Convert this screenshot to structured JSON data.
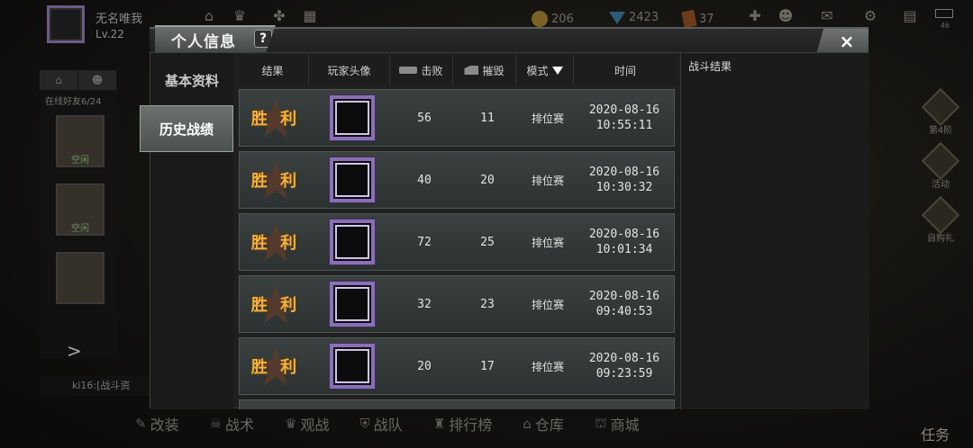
{
  "hud": {
    "player_name": "无名唯我",
    "player_level": "Lv.22",
    "coins": "206",
    "gems": "2423",
    "tickets": "37",
    "battery_label": "46"
  },
  "left_panel": {
    "online_text": "在线好友6/24",
    "friend_label": "空闲"
  },
  "chat_text": "ki16:[战斗资",
  "right_side": [
    "第4阶",
    "活动",
    "自购礼"
  ],
  "bottom_nav": [
    "改装",
    "战术",
    "观战",
    "战队",
    "排行榜",
    "仓库",
    "商城"
  ],
  "mission_label": "任务",
  "modal": {
    "title": "个人信息",
    "help": "?",
    "close": "×",
    "side_nav": [
      "基本资料",
      "历史战绩"
    ],
    "columns": {
      "result": "结果",
      "avatar": "玩家头像",
      "kills": "击败",
      "destroy": "摧毁",
      "mode": "模式",
      "time": "时间"
    },
    "rows": [
      {
        "result": "胜 利",
        "kills": "56",
        "destroy": "11",
        "mode": "排位赛",
        "date": "2020-08-16",
        "time": "10:55:11"
      },
      {
        "result": "胜 利",
        "kills": "40",
        "destroy": "20",
        "mode": "排位赛",
        "date": "2020-08-16",
        "time": "10:30:32"
      },
      {
        "result": "胜 利",
        "kills": "72",
        "destroy": "25",
        "mode": "排位赛",
        "date": "2020-08-16",
        "time": "10:01:34"
      },
      {
        "result": "胜 利",
        "kills": "32",
        "destroy": "23",
        "mode": "排位赛",
        "date": "2020-08-16",
        "time": "09:40:53"
      },
      {
        "result": "胜 利",
        "kills": "20",
        "destroy": "17",
        "mode": "排位赛",
        "date": "2020-08-16",
        "time": "09:23:59"
      }
    ],
    "result_panel_title": "战斗结果"
  }
}
